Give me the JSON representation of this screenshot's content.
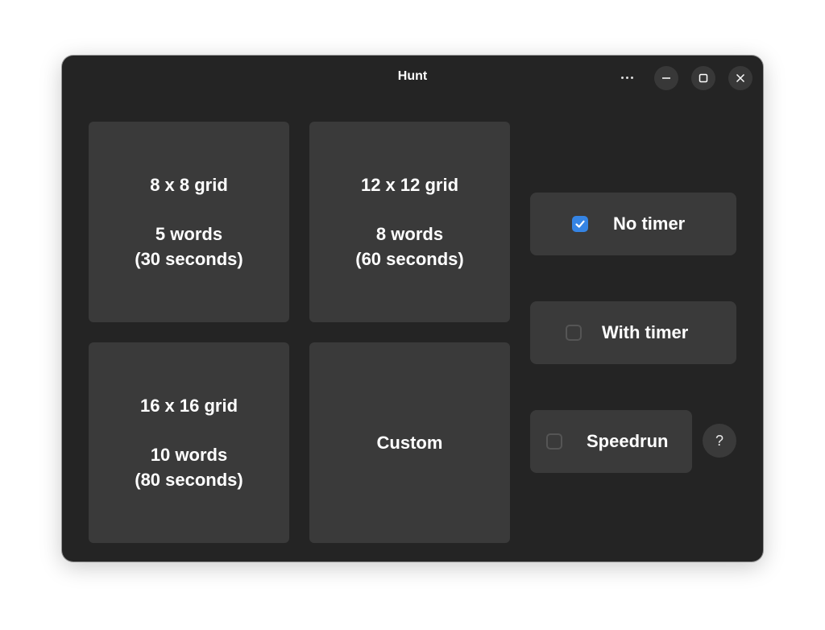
{
  "window": {
    "title": "Hunt",
    "controls": {
      "menu": "more-options",
      "minimize": "minimize",
      "maximize": "maximize",
      "close": "close"
    }
  },
  "modes": [
    {
      "title": "8 x 8 grid",
      "words": "5 words",
      "time": "(30 seconds)"
    },
    {
      "title": "12 x 12 grid",
      "words": "8 words",
      "time": "(60 seconds)"
    },
    {
      "title": "16 x 16 grid",
      "words": "10 words",
      "time": "(80 seconds)"
    },
    {
      "title": "Custom"
    }
  ],
  "options": [
    {
      "label": "No timer",
      "checked": true
    },
    {
      "label": "With timer",
      "checked": false
    },
    {
      "label": "Speedrun",
      "checked": false
    }
  ],
  "help": {
    "label": "?"
  },
  "colors": {
    "accent": "#3584e4",
    "window_bg": "#242424",
    "tile_bg": "#3a3a3a"
  }
}
